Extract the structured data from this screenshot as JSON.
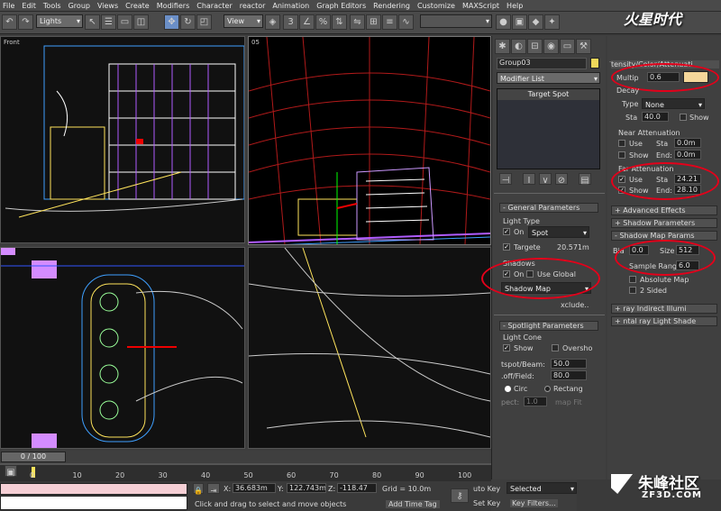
{
  "menu": [
    "File",
    "Edit",
    "Tools",
    "Group",
    "Views",
    "Create",
    "Modifiers",
    "Character",
    "reactor",
    "Animation",
    "Graph Editors",
    "Rendering",
    "Customize",
    "MAXScript",
    "Help"
  ],
  "toolbar": {
    "selection_filter": "Lights",
    "ref_coord": "View"
  },
  "viewports": {
    "top_left": "Front",
    "top_right": "05"
  },
  "panel": {
    "object_name": "Group03",
    "modifier_list": "Modifier List",
    "stack_item": "Target Spot",
    "general_title": "General Parameters",
    "light_type": "Light Type",
    "on": "On",
    "type_value": "Spot",
    "targeted": "Targete",
    "target_dist": "20.571m",
    "shadows": "Shadows",
    "shadows_on": "On",
    "use_global": "Use Global",
    "shadow_type": "Shadow Map",
    "exclude": "xclude..",
    "spot_title": "Spotlight Parameters",
    "light_cone": "Light Cone",
    "show_cone": "Show",
    "overshoot": "Oversho",
    "hotspot_label": "tspot/Beam:",
    "hotspot": "50.0",
    "falloff_label": ".off/Field:",
    "falloff": "80.0",
    "circle": "Circ",
    "rectangle": "Rectang",
    "aspect_label": "pect:",
    "aspect": "1.0",
    "bitmap_fit": "map Fit"
  },
  "panel2": {
    "title": "tensity/Color/Attenuati",
    "multiplier_label": "Multip",
    "multiplier": "0.6",
    "color": "#f5d79a",
    "decay": "Decay",
    "type_label": "Type",
    "type_value": "None",
    "start_label": "Sta",
    "start": "40.0",
    "show": "Show",
    "near_title": "Near Attenuation",
    "near_use": "Use",
    "near_start_label": "Sta",
    "near_start": "0.0m",
    "near_show": "Show",
    "near_end_label": "End:",
    "near_end": "0.0m",
    "far_title": "Far Attenuation",
    "far_use": "Use",
    "far_start_label": "Sta",
    "far_start": "24.21",
    "far_show": "Show",
    "far_end_label": "End:",
    "far_end": "28.10",
    "advanced": "Advanced Effects",
    "shadow_params": "Shadow Parameters",
    "shadow_map_params": "Shadow Map Params",
    "bias_label": "Bia",
    "bias": "0.0",
    "size_label": "Size",
    "size": "512",
    "sample_label": "Sample Range:",
    "sample": "6.0",
    "absolute": "Absolute Map",
    "two_sided": "2 Sided",
    "mr_indirect": "ray Indirect Illumi",
    "mr_shader": "ntal ray Light Shade"
  },
  "timeline": {
    "frame": "0 / 100",
    "ticks": [
      "0",
      "10",
      "20",
      "30",
      "40",
      "50",
      "60",
      "70",
      "80",
      "90",
      "100"
    ]
  },
  "status": {
    "x_label": "X:",
    "x": "36.683m",
    "y_label": "Y:",
    "y": "122.743m",
    "z_label": "Z:",
    "z": "-118.47",
    "grid": "Grid = 10.0m",
    "prompt": "Click and drag to select and move objects",
    "add_time_tag": "Add Time Tag",
    "auto_key": "uto Key",
    "set_key": "Set Key",
    "selected": "Selected",
    "key_filters": "Key Filters..."
  },
  "watermark": {
    "top": "火星时代",
    "bottom": "朱峰社区",
    "bottom_sub": "ZF3D.COM"
  }
}
